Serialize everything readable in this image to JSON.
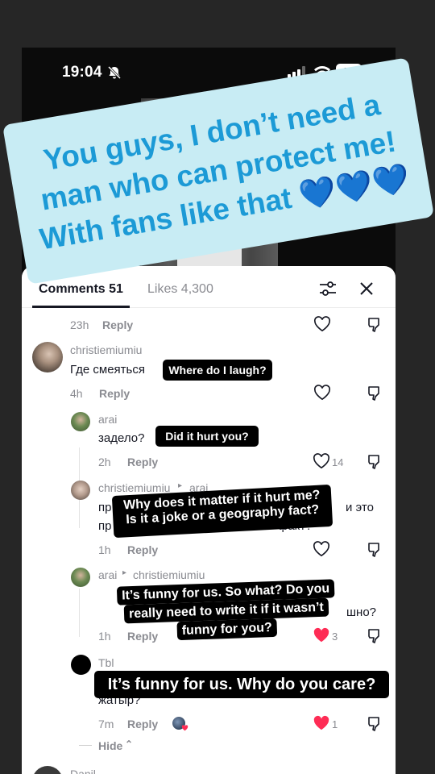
{
  "status": {
    "time": "19:04",
    "battery": "38"
  },
  "banner": {
    "text": "You guys, I don’t need a man who can protect me! With fans like that 💙💙💙"
  },
  "tabs": {
    "comments": "Comments 51",
    "likes": "Likes 4,300"
  },
  "comments": [
    {
      "time": "23h",
      "reply": "Reply"
    },
    {
      "user": "christiemiumiu",
      "text": "Где смеяться",
      "caption": "Where do I laugh?",
      "time": "4h",
      "reply": "Reply"
    },
    {
      "user": "arai",
      "text": "задело?",
      "caption": "Did it hurt you?",
      "time": "2h",
      "reply": "Reply",
      "likes": "14"
    },
    {
      "user": "christiemiumiu",
      "reply_to": "arai",
      "text_start": "пр",
      "text_end": "и это",
      "text_line2": "пр",
      "text_line2_tail": "факт?",
      "caption_line1": "Why does it matter if it hurt me?",
      "caption_line2": "Is it a joke or a geography fact?",
      "time": "1h",
      "reply": "Reply"
    },
    {
      "user": "arai",
      "reply_to": "christiemiumiu",
      "text_tail": "шно?",
      "caption_line1": "It’s funny for us. So what? Do you",
      "caption_line2": "really need to write it if it wasn’t",
      "caption_line3": "funny for you?",
      "time": "1h",
      "reply": "Reply",
      "likes": "3"
    },
    {
      "user": "Tbl",
      "text_tail": "жатыр?",
      "caption": "It’s funny for us. Why do you care?",
      "time": "7m",
      "reply": "Reply",
      "likes": "1"
    }
  ],
  "hide": "Hide",
  "next_user": "Danil",
  "colors": {
    "liked": "#fe2c55",
    "banner_text": "#1c9ad6",
    "banner_bg": "#c8ecf4"
  }
}
